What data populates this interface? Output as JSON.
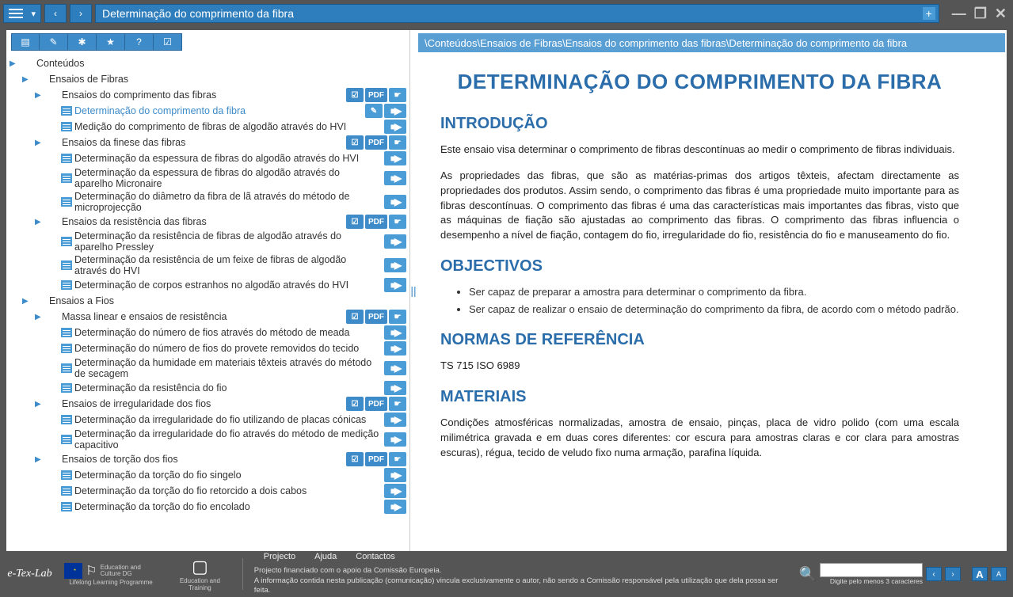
{
  "window": {
    "title": "Determinação do comprimento da fibra"
  },
  "breadcrumb": "\\Conteúdos\\Ensaios de Fibras\\Ensaios do comprimento das fibras\\Determinação do comprimento da fibra",
  "tree": [
    {
      "lvl": 0,
      "type": "folder",
      "label": "Conteúdos",
      "icons": []
    },
    {
      "lvl": 1,
      "type": "folder",
      "label": "Ensaios de Fibras",
      "icons": []
    },
    {
      "lvl": 2,
      "type": "folder",
      "label": "Ensaios do comprimento das fibras",
      "icons": [
        "chk",
        "pdf",
        "hand"
      ]
    },
    {
      "lvl": 3,
      "type": "doc",
      "label": "Determinação do comprimento da fibra",
      "icons": [
        "pen",
        "vid"
      ],
      "selected": true
    },
    {
      "lvl": 3,
      "type": "doc",
      "label": "Medição do comprimento de fibras de algodão através do HVI",
      "icons": [
        "vid"
      ]
    },
    {
      "lvl": 2,
      "type": "folder",
      "label": "Ensaios da finese das fibras",
      "icons": [
        "chk",
        "pdf",
        "hand"
      ]
    },
    {
      "lvl": 3,
      "type": "doc",
      "label": "Determinação da espessura de fibras do algodão através do HVI",
      "icons": [
        "vid"
      ]
    },
    {
      "lvl": 3,
      "type": "doc",
      "label": "Determinação da espessura de fibras do algodão através do aparelho Micronaire",
      "icons": [
        "vid"
      ]
    },
    {
      "lvl": 3,
      "type": "doc",
      "label": "Determinação do diâmetro da fibra de lã através do método de microprojecção",
      "icons": [
        "vid"
      ]
    },
    {
      "lvl": 2,
      "type": "folder",
      "label": "Ensaios da resistência das fibras",
      "icons": [
        "chk",
        "pdf",
        "hand"
      ]
    },
    {
      "lvl": 3,
      "type": "doc",
      "label": "Determinação da resistência de fibras de algodão através do aparelho Pressley",
      "icons": [
        "vid"
      ]
    },
    {
      "lvl": 3,
      "type": "doc",
      "label": "Determinação da resistência de um feixe de fibras de algodão através do HVI",
      "icons": [
        "vid"
      ]
    },
    {
      "lvl": 3,
      "type": "doc",
      "label": "Determinação de corpos estranhos no algodão através do HVI",
      "icons": [
        "vid"
      ]
    },
    {
      "lvl": 1,
      "type": "folder",
      "label": "Ensaios a Fios",
      "icons": []
    },
    {
      "lvl": 2,
      "type": "folder",
      "label": "Massa linear e ensaios de resistência",
      "icons": [
        "chk",
        "pdf",
        "hand"
      ]
    },
    {
      "lvl": 3,
      "type": "doc",
      "label": "Determinação do número de fios através do método de meada",
      "icons": [
        "vid"
      ]
    },
    {
      "lvl": 3,
      "type": "doc",
      "label": "Determinação do número de fios do provete removidos do tecido",
      "icons": [
        "vid"
      ]
    },
    {
      "lvl": 3,
      "type": "doc",
      "label": "Determinação da humidade em materiais têxteis através do método de secagem",
      "icons": [
        "vid"
      ]
    },
    {
      "lvl": 3,
      "type": "doc",
      "label": "Determinação da resistência do fio",
      "icons": [
        "vid"
      ]
    },
    {
      "lvl": 2,
      "type": "folder",
      "label": "Ensaios de irregularidade dos fios",
      "icons": [
        "chk",
        "pdf",
        "hand"
      ]
    },
    {
      "lvl": 3,
      "type": "doc",
      "label": "Determinação da irregularidade do fio utilizando de placas cónicas",
      "icons": [
        "vid"
      ]
    },
    {
      "lvl": 3,
      "type": "doc",
      "label": "Determinação da irregularidade do fio através do método de medição capacitivo",
      "icons": [
        "vid"
      ]
    },
    {
      "lvl": 2,
      "type": "folder",
      "label": "Ensaios de torção dos fios",
      "icons": [
        "chk",
        "pdf",
        "hand"
      ]
    },
    {
      "lvl": 3,
      "type": "doc",
      "label": "Determinação da torção do fio singelo",
      "icons": [
        "vid"
      ]
    },
    {
      "lvl": 3,
      "type": "doc",
      "label": "Determinação da torção do fio retorcido a dois cabos",
      "icons": [
        "vid"
      ]
    },
    {
      "lvl": 3,
      "type": "doc",
      "label": "Determinação da torção do fio encolado",
      "icons": [
        "vid"
      ]
    }
  ],
  "article": {
    "title": "DETERMINAÇÃO DO COMPRIMENTO DA FIBRA",
    "h_intro": "INTRODUÇÃO",
    "p1": "Este ensaio visa determinar o comprimento de fibras descontínuas ao medir o comprimento de fibras individuais.",
    "p2": "As propriedades das fibras, que são as matérias-primas dos artigos têxteis, afectam directamente as propriedades dos produtos. Assim sendo, o comprimento das fibras é uma propriedade muito importante para as fibras descontínuas. O comprimento das fibras é uma das características mais importantes das fibras, visto que as máquinas de fiação são ajustadas ao comprimento das fibras. O comprimento das fibras influencia o desempenho a nível de fiação, contagem do fio, irregularidade do fio, resistência do fio e manuseamento do fio.",
    "h_obj": "OBJECTIVOS",
    "li1": "Ser capaz de preparar a amostra para determinar o comprimento da fibra.",
    "li2": "Ser capaz de realizar o ensaio de determinação do comprimento da fibra, de acordo com o método padrão.",
    "h_norm": "NORMAS DE REFERÊNCIA",
    "p_norm": "TS 715 ISO 6989",
    "h_mat": "MATERIAIS",
    "p_mat": "Condições atmosféricas normalizadas, amostra de ensaio, pinças, placa de vidro polido (com uma escala milimétrica gravada e em duas cores diferentes: cor escura para amostras claras e cor clara para amostras escuras), régua, tecido de veludo fixo numa armação, parafina líquida."
  },
  "footer": {
    "links": {
      "projecto": "Projecto",
      "ajuda": "Ajuda",
      "contactos": "Contactos"
    },
    "line1": "Projecto financiado com o apoio da Comissão Europeia.",
    "line2": "A informação contida nesta publicação (comunicação) vincula exclusivamente o autor, não sendo a Comissão responsável pela utilização que dela possa ser feita.",
    "edu1": "Education and Culture DG",
    "edu2": "Lifelong Learning Programme",
    "edu3": "Education and Training",
    "search_hint": "Digite pelo menos 3 caracteres",
    "btn_a1": "A",
    "btn_a2": "A"
  }
}
